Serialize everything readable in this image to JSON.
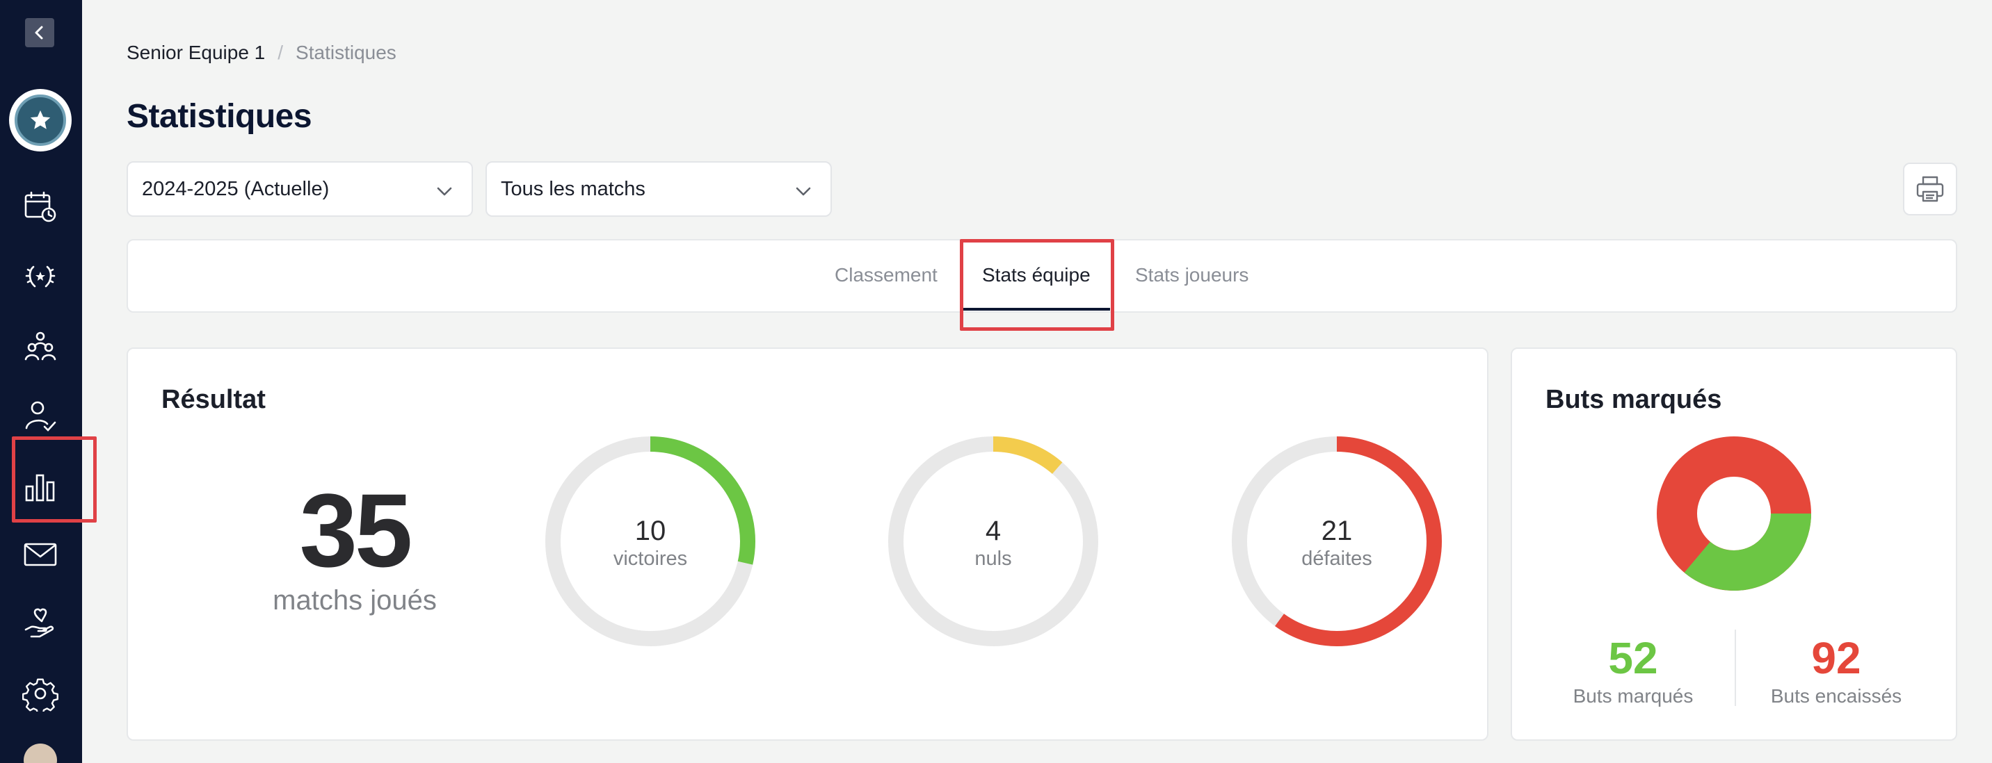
{
  "breadcrumb": {
    "team": "Senior Equipe 1",
    "separator": "/",
    "current": "Statistiques"
  },
  "page_title": "Statistiques",
  "filters": {
    "season": "2024-2025 (Actuelle)",
    "matches": "Tous les matchs"
  },
  "tabs": [
    {
      "label": "Classement"
    },
    {
      "label": "Stats équipe",
      "active": true
    },
    {
      "label": "Stats joueurs"
    }
  ],
  "resultat": {
    "title": "Résultat",
    "played": {
      "value": "35",
      "label": "matchs joués"
    },
    "wins": {
      "value": "10",
      "label": "victoires",
      "fraction": 0.2857,
      "color": "#6cc644"
    },
    "draws": {
      "value": "4",
      "label": "nuls",
      "fraction": 0.1143,
      "color": "#f3cc4d"
    },
    "losses": {
      "value": "21",
      "label": "défaites",
      "fraction": 0.6,
      "color": "#e5473a"
    }
  },
  "goals": {
    "title": "Buts marqués",
    "scored": {
      "value": "52",
      "label": "Buts marqués",
      "color": "#6cc644"
    },
    "conceded": {
      "value": "92",
      "label": "Buts encaissés",
      "color": "#e5473a"
    }
  },
  "sidebar": {
    "items": [
      "calendar-icon",
      "trophy-laurel-icon",
      "team-icon",
      "player-check-icon",
      "bar-chart-icon",
      "mail-icon",
      "hand-heart-icon",
      "gear-icon"
    ]
  },
  "colors": {
    "navy": "#0c1631",
    "highlight": "#e04146",
    "ring_track": "#e8e8e8"
  }
}
